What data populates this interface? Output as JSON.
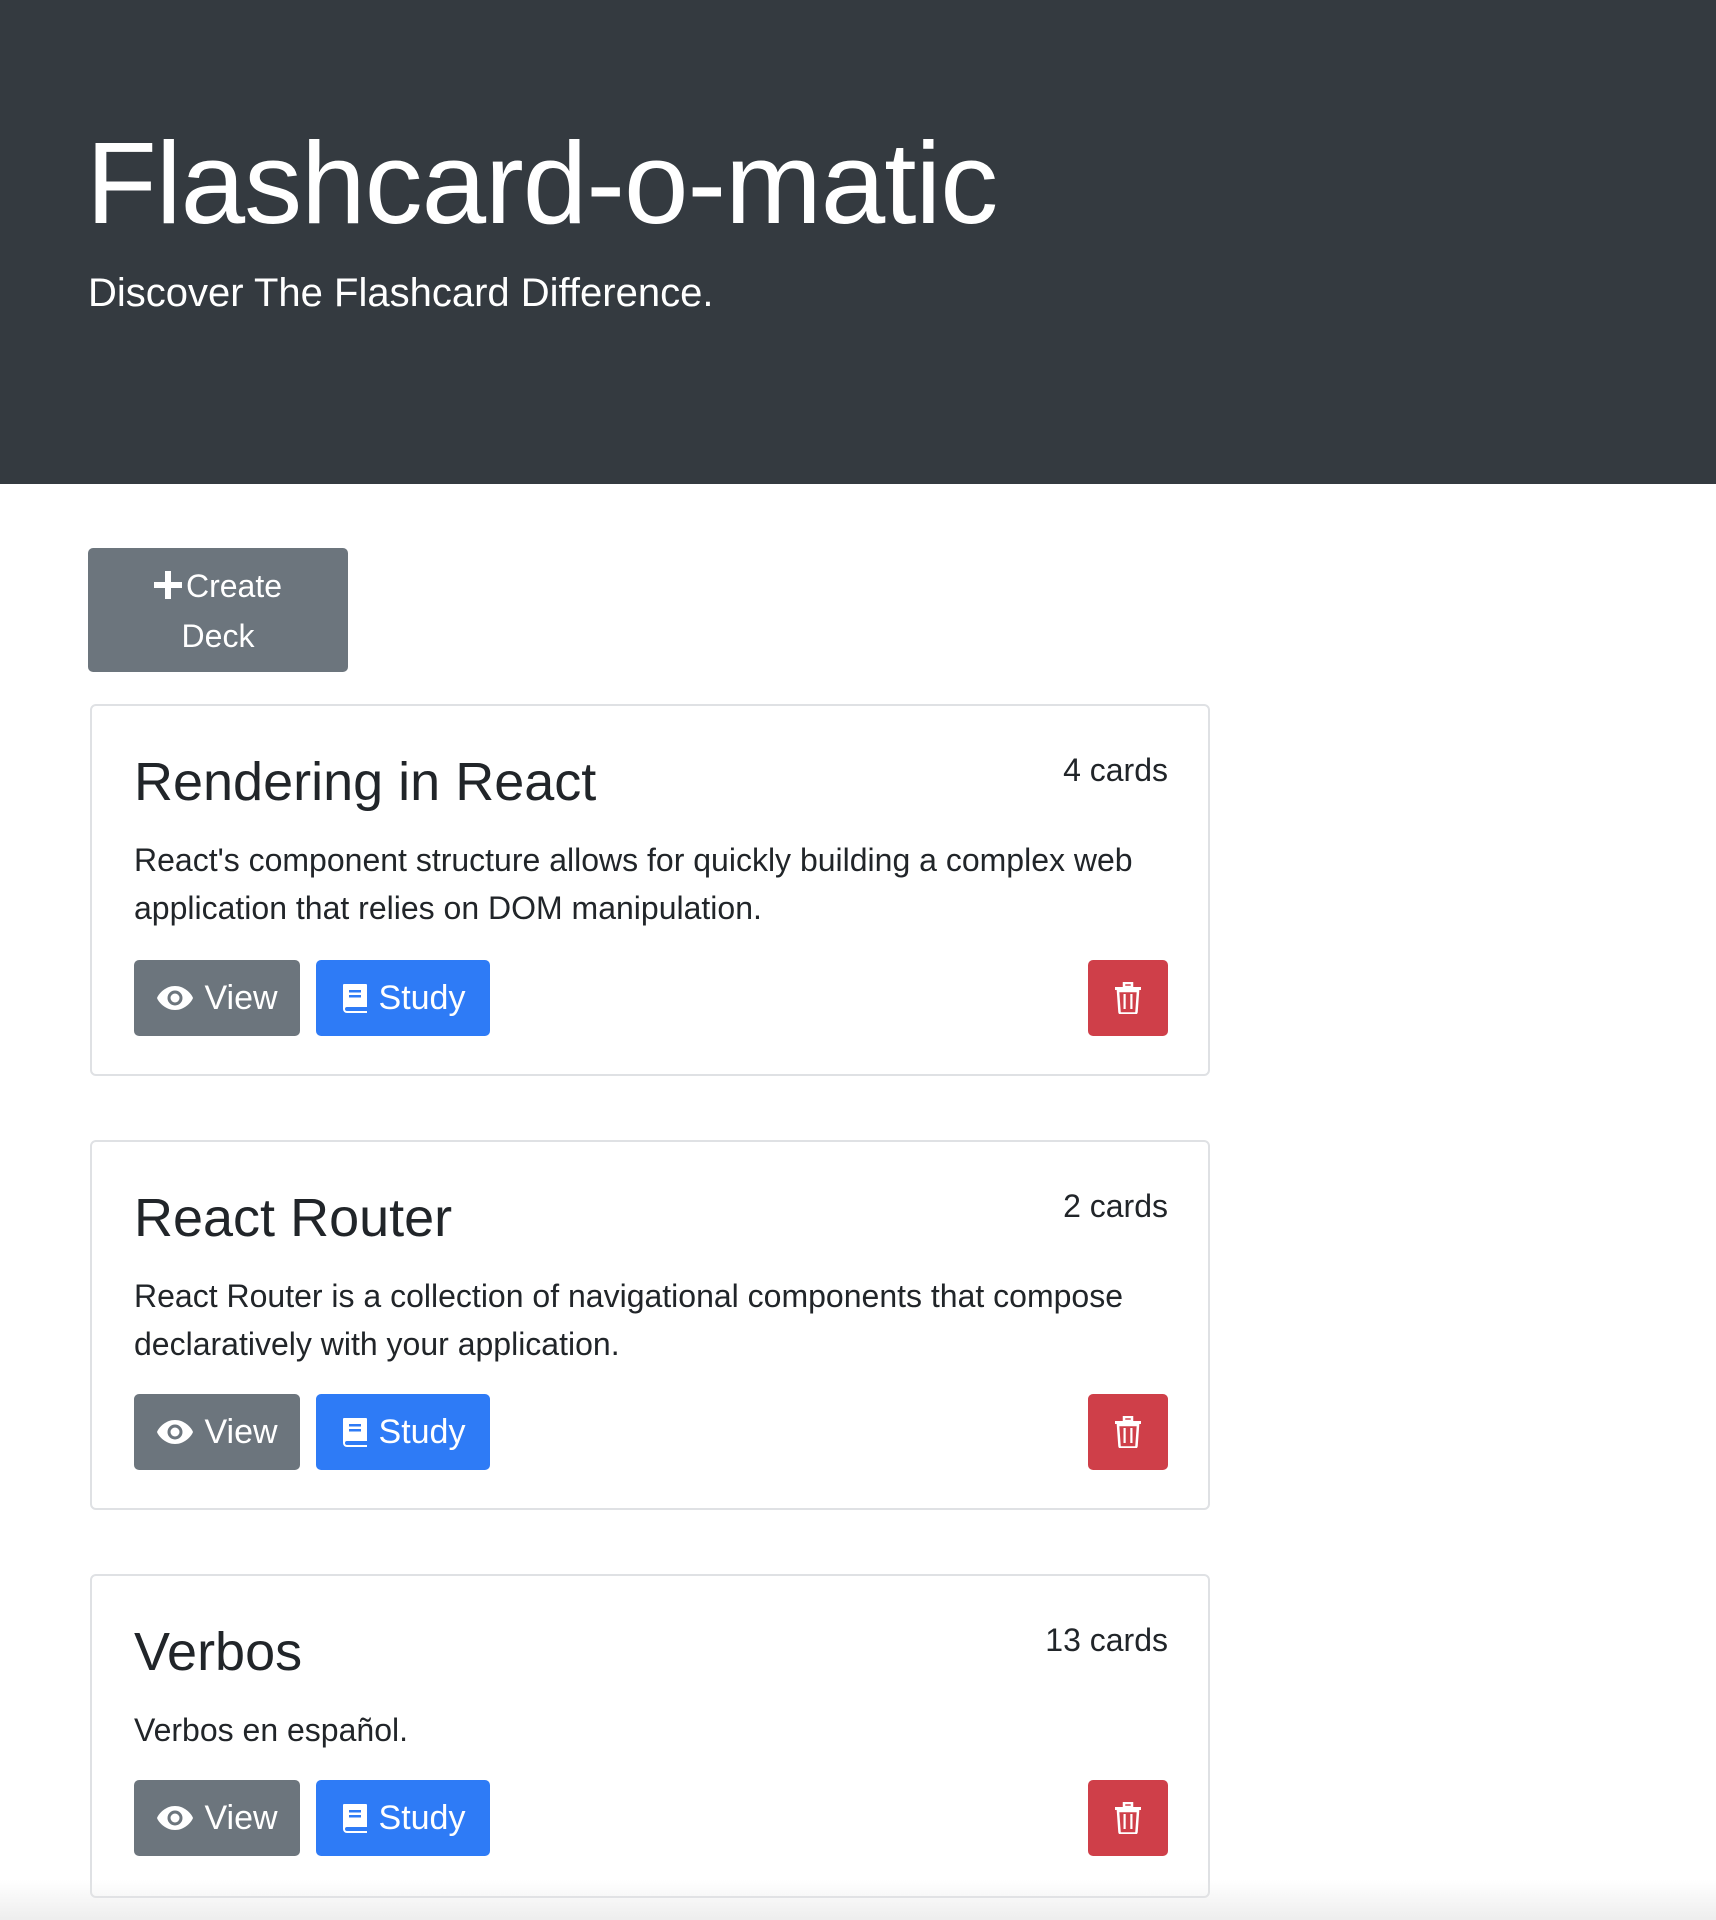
{
  "header": {
    "title": "Flashcard-o-matic",
    "subtitle": "Discover The Flashcard Difference."
  },
  "create_deck": {
    "line1": "Create",
    "line2": "Deck",
    "icon": "plus-icon"
  },
  "decks": [
    {
      "title": "Rendering in React",
      "count": "4 cards",
      "description": "React's component structure allows for quickly building a complex web application that relies on DOM manipulation.",
      "view_label": "View",
      "study_label": "Study"
    },
    {
      "title": "React Router",
      "count": "2 cards",
      "description": "React Router is a collection of navigational components that compose declaratively with your application.",
      "view_label": "View",
      "study_label": "Study"
    },
    {
      "title": "Verbos",
      "count": "13 cards",
      "description": "Verbos en español.",
      "view_label": "View",
      "study_label": "Study"
    }
  ],
  "colors": {
    "jumbotron": "#343a40",
    "secondary": "#6c757d",
    "primary": "#2e7bf6",
    "danger": "#cf3f49"
  },
  "icons": {
    "view": "eye-icon",
    "study": "book-icon",
    "delete": "trash-icon"
  }
}
